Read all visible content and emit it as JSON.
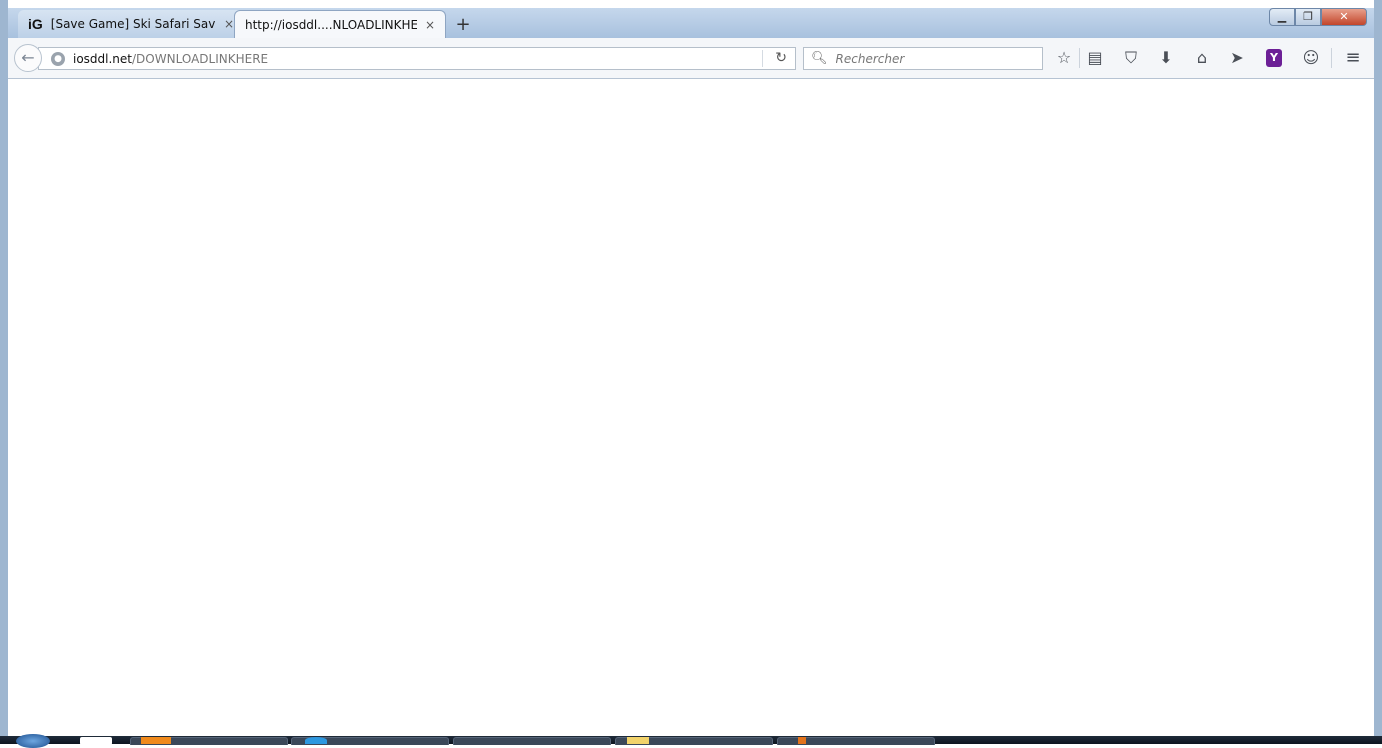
{
  "tabs": [
    {
      "favicon": "iG",
      "label": "[Save Game] Ski Safari Save...",
      "close": "×",
      "active": false
    },
    {
      "favicon": "",
      "label": "http://iosddl....NLOADLINKHERE",
      "close": "×",
      "active": true
    }
  ],
  "new_tab_label": "+",
  "window_controls": {
    "minimize": "▁",
    "maximize": "❐",
    "close": "✕"
  },
  "navbar": {
    "back_icon": "←",
    "url_host": "iosddl.net",
    "url_path": "/DOWNLOADLINKHERE",
    "reload_icon": "↻",
    "search_placeholder": "Rechercher",
    "icons": {
      "bookmark": "☆",
      "reading_list": "▤",
      "pocket": "⛉",
      "downloads": "⬇",
      "home": "⌂",
      "send": "➤",
      "shortcut": "Y",
      "chat": "☺",
      "menu": "≡"
    }
  },
  "colors": {
    "titlebar": "#b9cde4",
    "toolbar": "#f4f6f9",
    "close_button": "#c2452b"
  }
}
